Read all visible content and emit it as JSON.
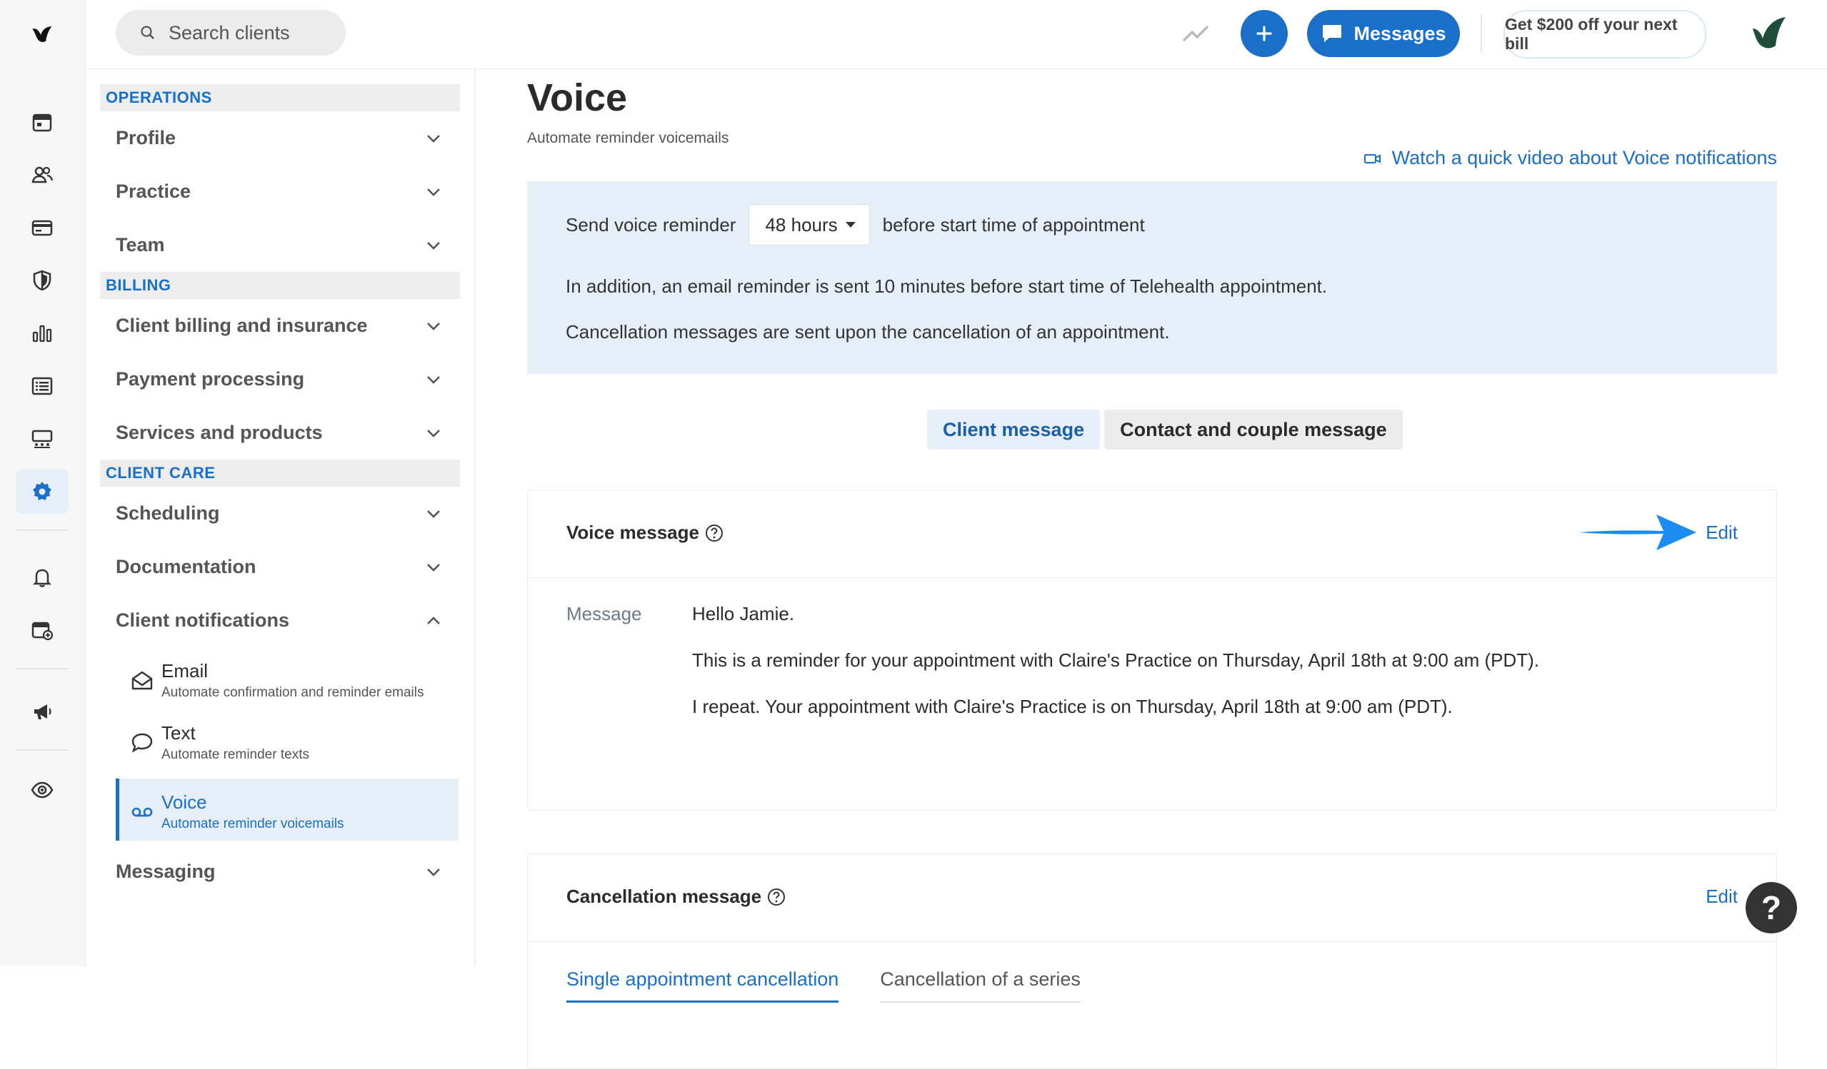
{
  "rail": {
    "items": [
      {
        "name": "calendar-icon"
      },
      {
        "name": "clients-icon"
      },
      {
        "name": "billing-card-icon"
      },
      {
        "name": "insurance-shield-icon"
      },
      {
        "name": "analytics-icon"
      },
      {
        "name": "reports-list-icon"
      },
      {
        "name": "marketplace-icon"
      },
      {
        "name": "settings-gear-icon"
      },
      {
        "name": "notifications-bell-icon"
      },
      {
        "name": "calendar-add-icon"
      },
      {
        "name": "announcements-megaphone-icon"
      },
      {
        "name": "preview-eye-icon"
      }
    ],
    "active": "settings-gear-icon"
  },
  "topbar": {
    "search_placeholder": "Search clients",
    "messages_label": "Messages",
    "promo_label": "Get $200 off your next bill"
  },
  "nav": {
    "sections": [
      {
        "heading": "OPERATIONS",
        "items": [
          "Profile",
          "Practice",
          "Team"
        ]
      },
      {
        "heading": "BILLING",
        "items": [
          "Client billing and insurance",
          "Payment processing",
          "Services and products"
        ]
      },
      {
        "heading": "CLIENT CARE",
        "items": [
          "Scheduling",
          "Documentation",
          "Client notifications"
        ]
      }
    ],
    "notifications_sub": [
      {
        "title": "Email",
        "subtitle": "Automate confirmation and reminder emails"
      },
      {
        "title": "Text",
        "subtitle": "Automate reminder texts"
      },
      {
        "title": "Voice",
        "subtitle": "Automate reminder voicemails"
      }
    ],
    "last_item": "Messaging"
  },
  "page": {
    "title": "Voice",
    "subtitle": "Automate reminder voicemails",
    "video_link": "Watch a quick video about Voice notifications"
  },
  "info": {
    "prefix": "Send voice reminder",
    "hours_value": "48 hours",
    "suffix": "before start time of appointment",
    "line2": "In addition, an email reminder is sent 10 minutes before start time of Telehealth appointment.",
    "line3": "Cancellation messages are sent upon the cancellation of an appointment."
  },
  "tabs": {
    "client": "Client message",
    "contact": "Contact and couple message"
  },
  "voice_card": {
    "title": "Voice message",
    "edit": "Edit",
    "label": "Message",
    "lines": [
      "Hello Jamie.",
      "This is a reminder for your appointment with Claire's Practice on Thursday, April 18th at 9:00 am (PDT).",
      "I repeat. Your appointment with Claire's Practice is on Thursday, April 18th at 9:00 am (PDT)."
    ]
  },
  "cancel_card": {
    "title": "Cancellation message",
    "edit": "Edit",
    "tabs": [
      "Single appointment cancellation",
      "Cancellation of a series"
    ]
  },
  "help": "?",
  "colors": {
    "accent": "#1a6fc9",
    "highlight": "#e6eef8",
    "text": "#2b2b2b"
  }
}
